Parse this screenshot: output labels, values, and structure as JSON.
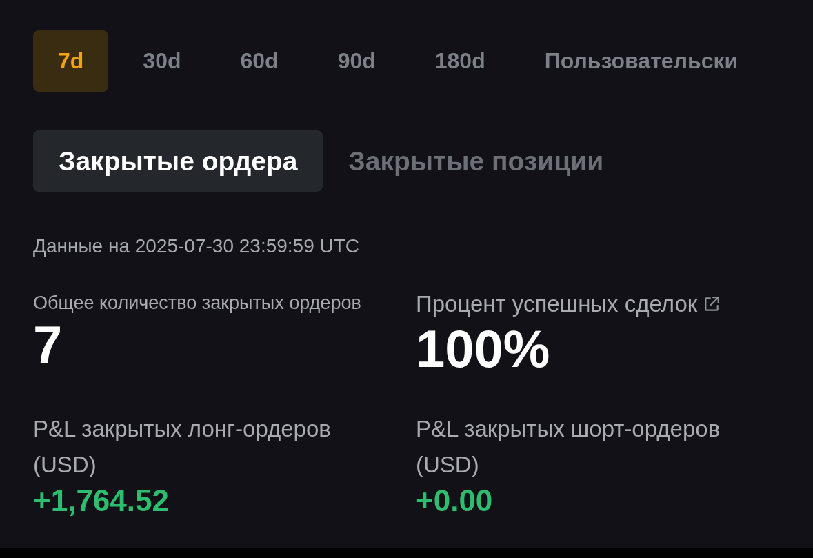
{
  "period_tabs": [
    {
      "label": "7d",
      "selected": true
    },
    {
      "label": "30d",
      "selected": false
    },
    {
      "label": "60d",
      "selected": false
    },
    {
      "label": "90d",
      "selected": false
    },
    {
      "label": "180d",
      "selected": false
    },
    {
      "label": "Пользовательски",
      "selected": false
    }
  ],
  "view_tabs": [
    {
      "label": "Закрытые ордера",
      "selected": true
    },
    {
      "label": "Закрытые позиции",
      "selected": false
    }
  ],
  "data_as_of": "Данные на 2025-07-30 23:59:59 UTC",
  "total_closed_orders": {
    "label": "Общее количество закрытых ордеров",
    "value": "7"
  },
  "win_rate": {
    "label": "Процент успешных сделок",
    "value": "100%"
  },
  "pnl": [
    {
      "label": "P&L закрытых лонг-ордеров (USD)",
      "value": "+1,764.52"
    },
    {
      "label": "P&L закрытых шорт-ордеров (USD)",
      "value": "+0.00"
    }
  ]
}
